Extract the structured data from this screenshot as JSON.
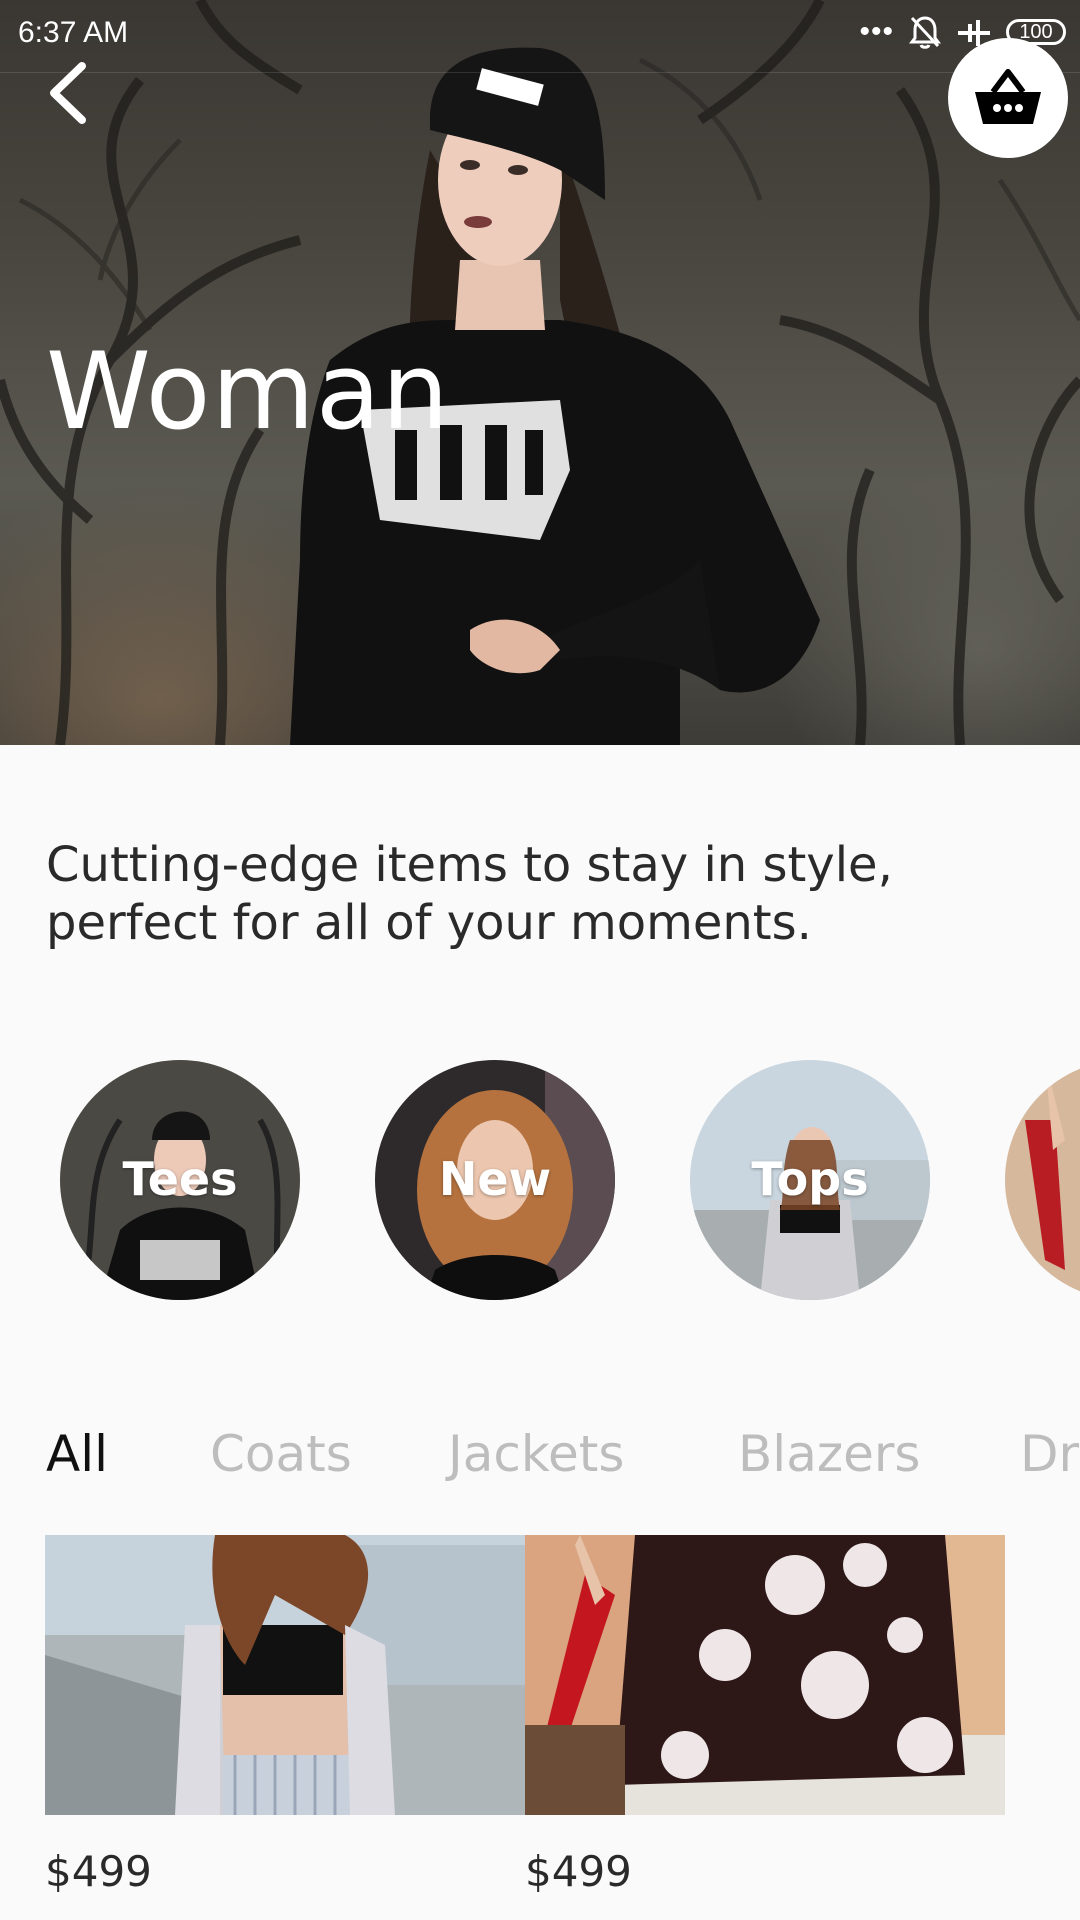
{
  "status_bar": {
    "time": "6:37 AM",
    "dots": "•••",
    "battery": "100"
  },
  "header": {
    "title": "Woman",
    "back_icon": "chevron-left-icon",
    "cart_icon": "basket-icon"
  },
  "description": "Cutting-edge items to stay in style, perfect for all of your moments.",
  "categories": [
    {
      "label": "Tees"
    },
    {
      "label": "New"
    },
    {
      "label": "Tops"
    },
    {
      "label": ""
    }
  ],
  "tabs": [
    {
      "label": "All",
      "active": true
    },
    {
      "label": "Coats",
      "active": false
    },
    {
      "label": "Jackets",
      "active": false
    },
    {
      "label": "Blazers",
      "active": false
    },
    {
      "label": "Dr",
      "active": false
    }
  ],
  "products": [
    {
      "price": "$499"
    },
    {
      "price": "$499"
    }
  ],
  "colors": {
    "background": "#fafafa",
    "tab_active": "#111111",
    "tab_inactive": "#bdbdbd",
    "text": "#2a2a2a"
  }
}
